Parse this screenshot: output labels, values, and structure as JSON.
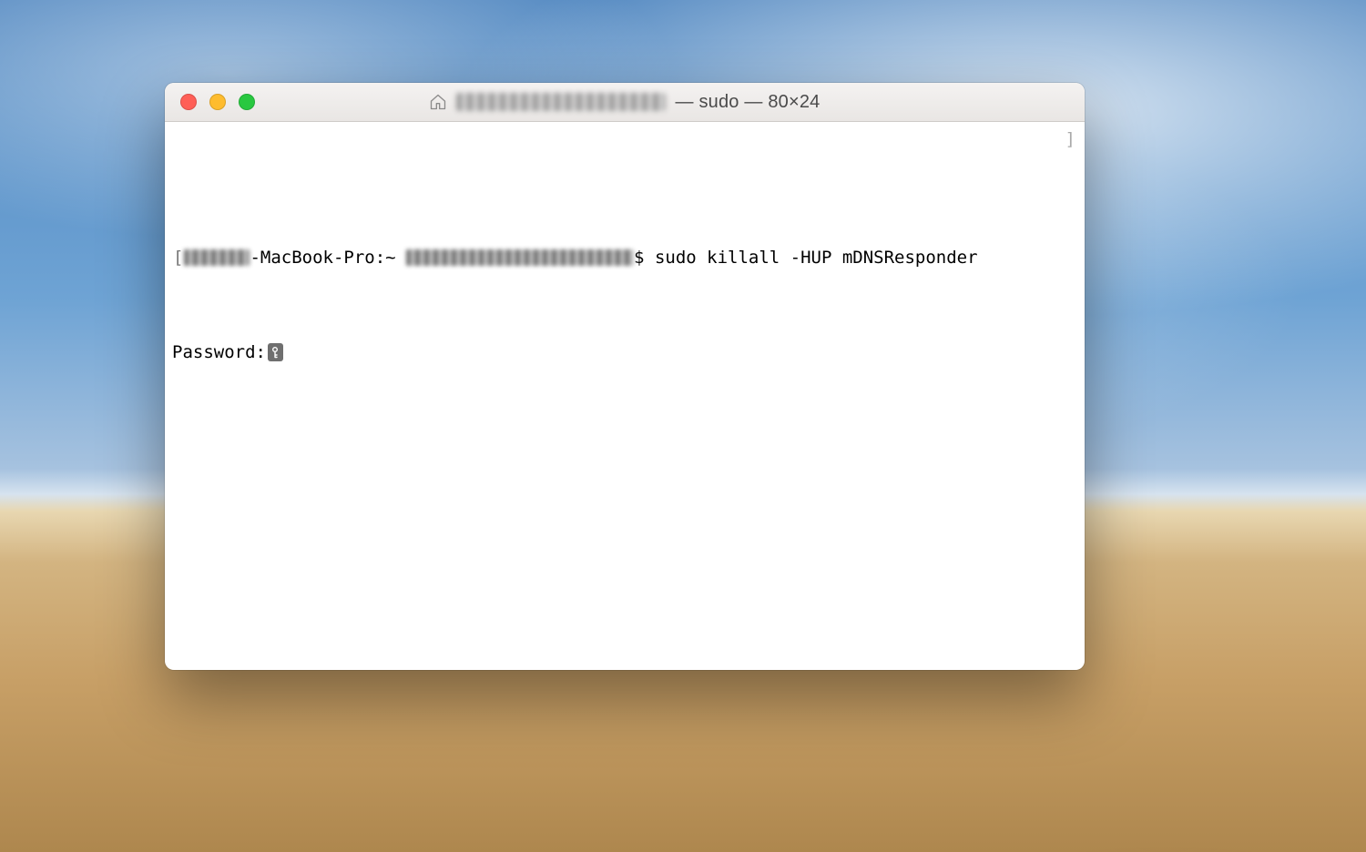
{
  "window": {
    "title_suffix": " — sudo — 80×24"
  },
  "terminal": {
    "prompt_host_suffix": "-MacBook-Pro:~ ",
    "prompt_symbol": "$ ",
    "command": "sudo killall -HUP mDNSResponder",
    "password_prompt": "Password:"
  },
  "brackets": {
    "left": "[",
    "right": "]"
  }
}
